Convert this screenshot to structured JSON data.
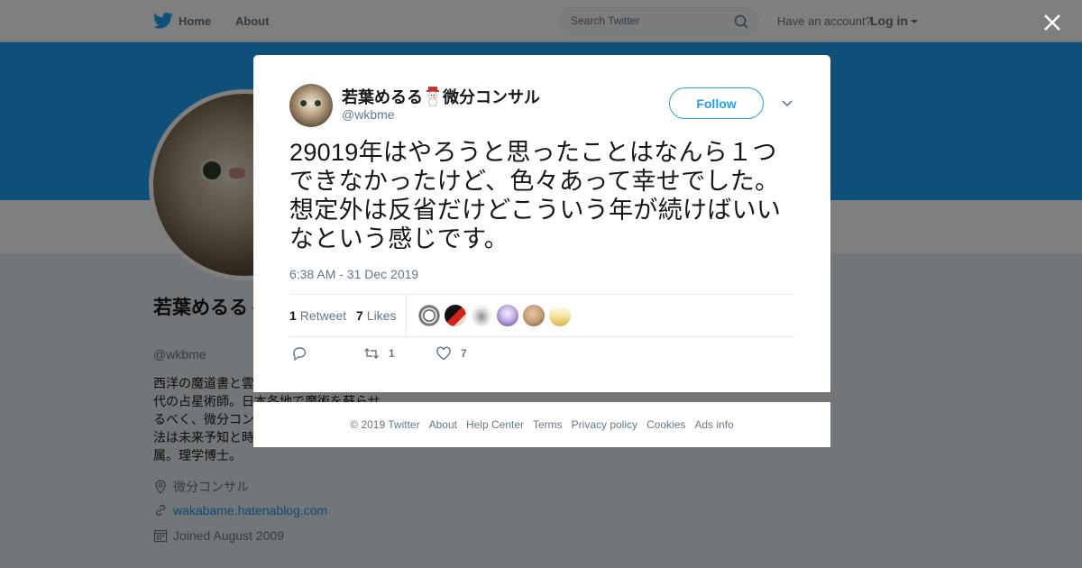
{
  "topbar": {
    "home_label": "Home",
    "about_label": "About",
    "search_placeholder": "Search Twitter",
    "have_account": "Have an account?",
    "login_label": "Log in"
  },
  "profile": {
    "name": "若葉めるる⛄微分コンサル",
    "handle": "@wkbme",
    "bio": "西洋の魔道書と雲の上の占星術を嗜む現代の占星術師。日本各地で魔術を蘇らせるべく、微分コンサルとして活動中。手法は未来予知と時間旅行。微分教団に所属。理学博士。",
    "location": "微分コンサル",
    "website": "wakabame.hatenablog.com",
    "joined": "Joined August 2009"
  },
  "tweet": {
    "fullname_part1": "若葉めるる",
    "fullname_part2": "微分コンサル",
    "username": "@wkbme",
    "follow_label": "Follow",
    "text": "29019年はやろうと思ったことはなんら１つできなかったけど、色々あって幸せでした。想定外は反省だけどこういう年が続けばいいなという感じです。",
    "timestamp": "6:38 AM - 31 Dec 2019",
    "retweet_count": "1",
    "retweet_label": "Retweet",
    "like_count": "7",
    "like_label": "Likes",
    "action_retweet_count": "1",
    "action_like_count": "7"
  },
  "footer": {
    "copyright": "© 2019 Twitter",
    "about": "About",
    "help": "Help Center",
    "terms": "Terms",
    "privacy": "Privacy policy",
    "cookies": "Cookies",
    "ads": "Ads info"
  },
  "colors": {
    "accent": "#1da1f2",
    "banner": "#1da1f2",
    "muted": "#657786"
  }
}
